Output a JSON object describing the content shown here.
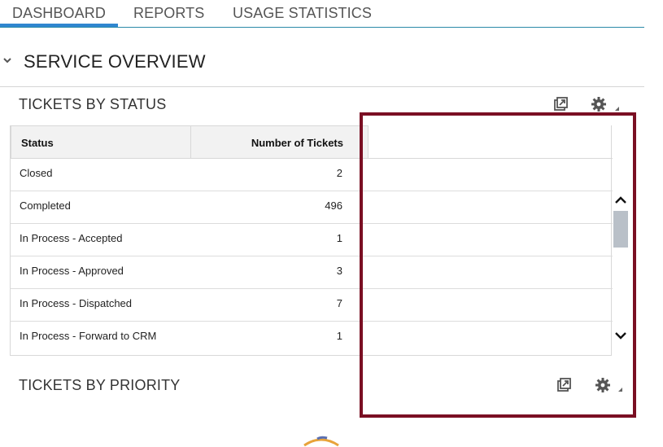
{
  "tabs": [
    {
      "label": "DASHBOARD",
      "active": true
    },
    {
      "label": "REPORTS",
      "active": false
    },
    {
      "label": "USAGE STATISTICS",
      "active": false
    }
  ],
  "section": {
    "title": "SERVICE OVERVIEW"
  },
  "widgets": {
    "status": {
      "title": "TICKETS BY STATUS",
      "columns": [
        "Status",
        "Number of Tickets"
      ],
      "rows": [
        {
          "status": "Closed",
          "count": "2"
        },
        {
          "status": "Completed",
          "count": "496"
        },
        {
          "status": "In Process - Accepted",
          "count": "1"
        },
        {
          "status": "In Process - Approved",
          "count": "3"
        },
        {
          "status": "In Process - Dispatched",
          "count": "7"
        },
        {
          "status": "In Process - Forward to CRM",
          "count": "1"
        }
      ]
    },
    "priority": {
      "title": "TICKETS BY PRIORITY"
    }
  },
  "icons": {
    "maximize": "maximize-icon",
    "settings": "gear-icon",
    "collapse": "chevron-down-icon",
    "scroll_up": "chevron-up-icon",
    "scroll_down": "chevron-down-icon"
  },
  "colors": {
    "tab_underline": "#2f86d0",
    "tabs_border": "#2a8aa8",
    "highlight": "#7a0f23",
    "scroll_thumb": "#b9c0c8"
  }
}
